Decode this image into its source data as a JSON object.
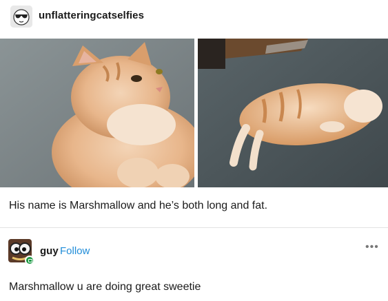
{
  "post": {
    "author": "unflatteringcatselfies",
    "caption": "His name is Marshmallow and he’s both long and fat.",
    "photos": [
      {
        "icon": "cat-closeup-photo"
      },
      {
        "icon": "cat-lying-on-carpet-photo"
      }
    ]
  },
  "reply": {
    "author": "guy",
    "follow_label": "Follow",
    "more_label": "•••",
    "text": "Marshmallow u are doing great sweetie"
  },
  "colors": {
    "follow_link": "#1f8cd8",
    "badge": "#1e9b46",
    "divider": "#e2e2e2"
  }
}
